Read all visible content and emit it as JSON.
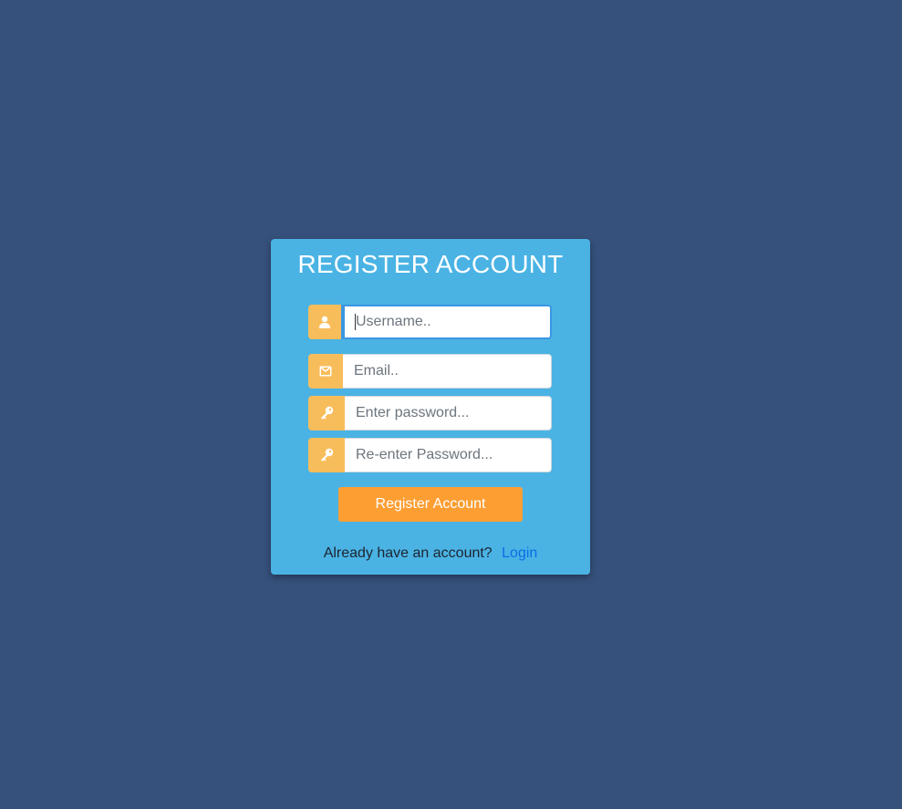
{
  "page": {
    "background": "#36517c",
    "card_color": "#4ab3e4",
    "addon_color": "#f8bd5b",
    "button_color": "#fd9e33",
    "link_color": "#0a6ee6"
  },
  "form": {
    "title": "REGISTER ACCOUNT",
    "fields": [
      {
        "name": "username",
        "icon": "user-icon",
        "placeholder": "Username..",
        "value": "",
        "focused": true
      },
      {
        "name": "email",
        "icon": "envelope-icon",
        "placeholder": "Email..",
        "value": ""
      },
      {
        "name": "password",
        "icon": "key-icon",
        "placeholder": "Enter password...",
        "value": ""
      },
      {
        "name": "confirm_password",
        "icon": "key-icon",
        "placeholder": "Re-enter Password...",
        "value": ""
      }
    ],
    "submit_label": "Register Account",
    "footer_text": "Already have an account?",
    "login_link": "Login"
  }
}
